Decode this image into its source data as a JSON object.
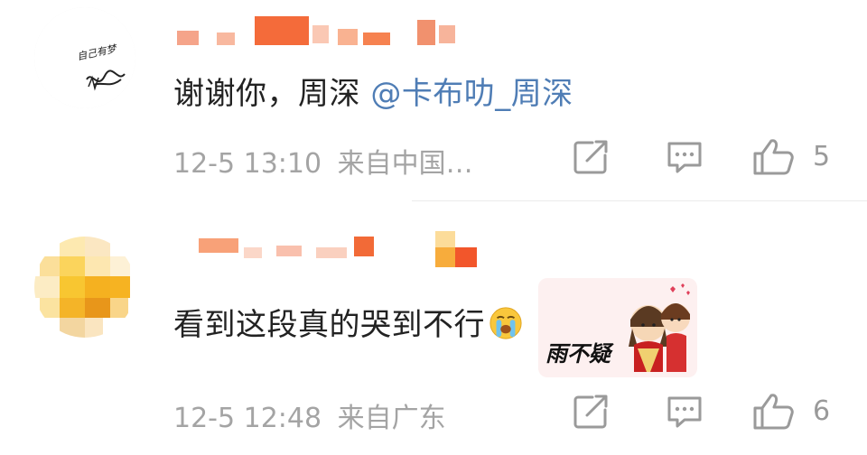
{
  "comments": [
    {
      "text": "谢谢你，周深 ",
      "mention": "@卡布叻_周深",
      "time": "12-5 13:10",
      "location": "来自中国…",
      "likes": "5",
      "avatar_text": "自己有梦"
    },
    {
      "text": "看到这段真的哭到不行",
      "emoji": "loudly-crying-face-emoji",
      "sticker_caption": "雨不疑",
      "time": "12-5 12:48",
      "location": "来自广东",
      "likes": "6"
    }
  ],
  "icons": {
    "share": "share-icon",
    "reply": "comment-icon",
    "like": "thumbs-up-icon"
  },
  "colors": {
    "mention": "#4f7db5",
    "meta": "#a4a4a4",
    "text": "#222222",
    "icon": "#9a9a9a"
  }
}
